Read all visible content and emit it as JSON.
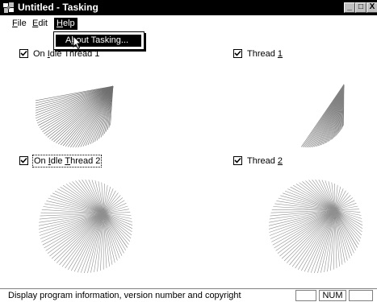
{
  "window": {
    "title": "Untitled - Tasking",
    "minimize_glyph": "_",
    "maximize_glyph": "□",
    "close_glyph": "X"
  },
  "menu": {
    "file": {
      "label": "File",
      "mnemonic": "F",
      "rest": "ile"
    },
    "edit": {
      "label": "Edit",
      "mnemonic": "E",
      "rest": "dit"
    },
    "help": {
      "label": "Help",
      "mnemonic": "H",
      "rest": "elp"
    }
  },
  "help_menu": {
    "about": {
      "label": "About Tasking...",
      "pre": "A",
      "mnemonic": "b",
      "rest": "out Tasking..."
    }
  },
  "panels": {
    "idle_thread_1": {
      "checked": true,
      "label": "On Idle Thread 1",
      "pre": "On ",
      "mnemonic": "I",
      "rest": "dle Thread 1"
    },
    "thread_1": {
      "checked": true,
      "label": "Thread 1",
      "pre": "Thread ",
      "mnemonic": "1",
      "rest": ""
    },
    "idle_thread_2": {
      "checked": true,
      "label": "On Idle Thread 2",
      "pre": "On ",
      "mnemonic": "I",
      "mid": "dle ",
      "mnemonic2": "T",
      "rest": "hread 2"
    },
    "thread_2": {
      "checked": true,
      "label": "Thread 2",
      "pre": "Thread ",
      "mnemonic": "2",
      "rest": ""
    }
  },
  "fans": [
    {
      "id": "idle_thread_1",
      "progress": 0.45,
      "lines": 46,
      "color": "#707070"
    },
    {
      "id": "thread_1",
      "progress": 0.2,
      "lines": 40,
      "color": "#808080"
    },
    {
      "id": "idle_thread_2",
      "progress": 1.0,
      "lines": 90,
      "color": "#909090"
    },
    {
      "id": "thread_2",
      "progress": 1.0,
      "lines": 90,
      "color": "#909090"
    }
  ],
  "statusbar": {
    "message": "Display program information, version number and copyright",
    "num_indicator": "NUM"
  },
  "colors": {
    "title_bar": "#000000",
    "menu_highlight": "#000000",
    "fan_lines": "#808080"
  }
}
